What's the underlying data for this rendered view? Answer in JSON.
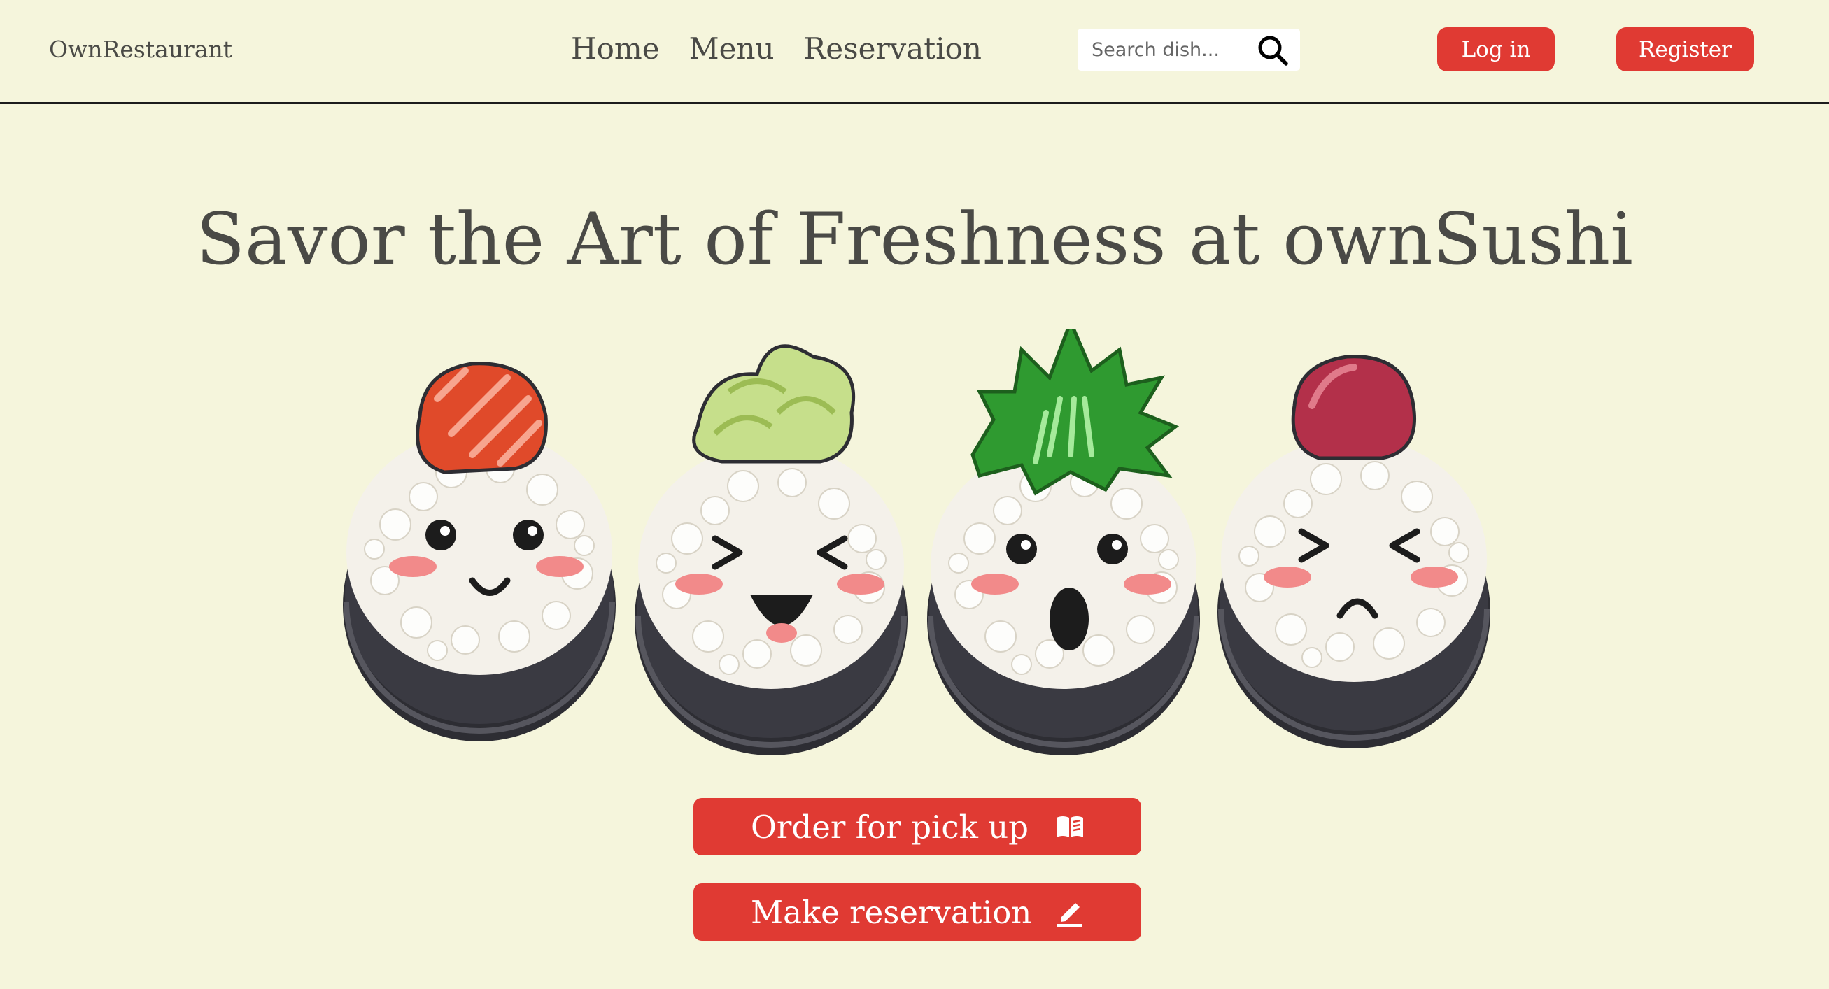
{
  "header": {
    "brand": "OwnRestaurant",
    "nav": [
      {
        "label": "Home"
      },
      {
        "label": "Menu"
      },
      {
        "label": "Reservation"
      }
    ],
    "search": {
      "placeholder": "Search dish...",
      "icon": "search-icon"
    },
    "login_label": "Log in",
    "register_label": "Register"
  },
  "hero": {
    "title": "Savor the Art of Freshness at ownSushi",
    "illustration": [
      "salmon-sushi-smiling",
      "cucumber-sushi-laughing",
      "seaweed-sushi-surprised",
      "tuna-sushi-frowning"
    ]
  },
  "actions": {
    "order_label": "Order for pick up",
    "order_icon": "menu-book-icon",
    "reserve_label": "Make reservation",
    "reserve_icon": "edit-pencil-icon"
  },
  "colors": {
    "background": "#f5f5dc",
    "accent": "#e03a33",
    "text": "#4a4a46"
  }
}
